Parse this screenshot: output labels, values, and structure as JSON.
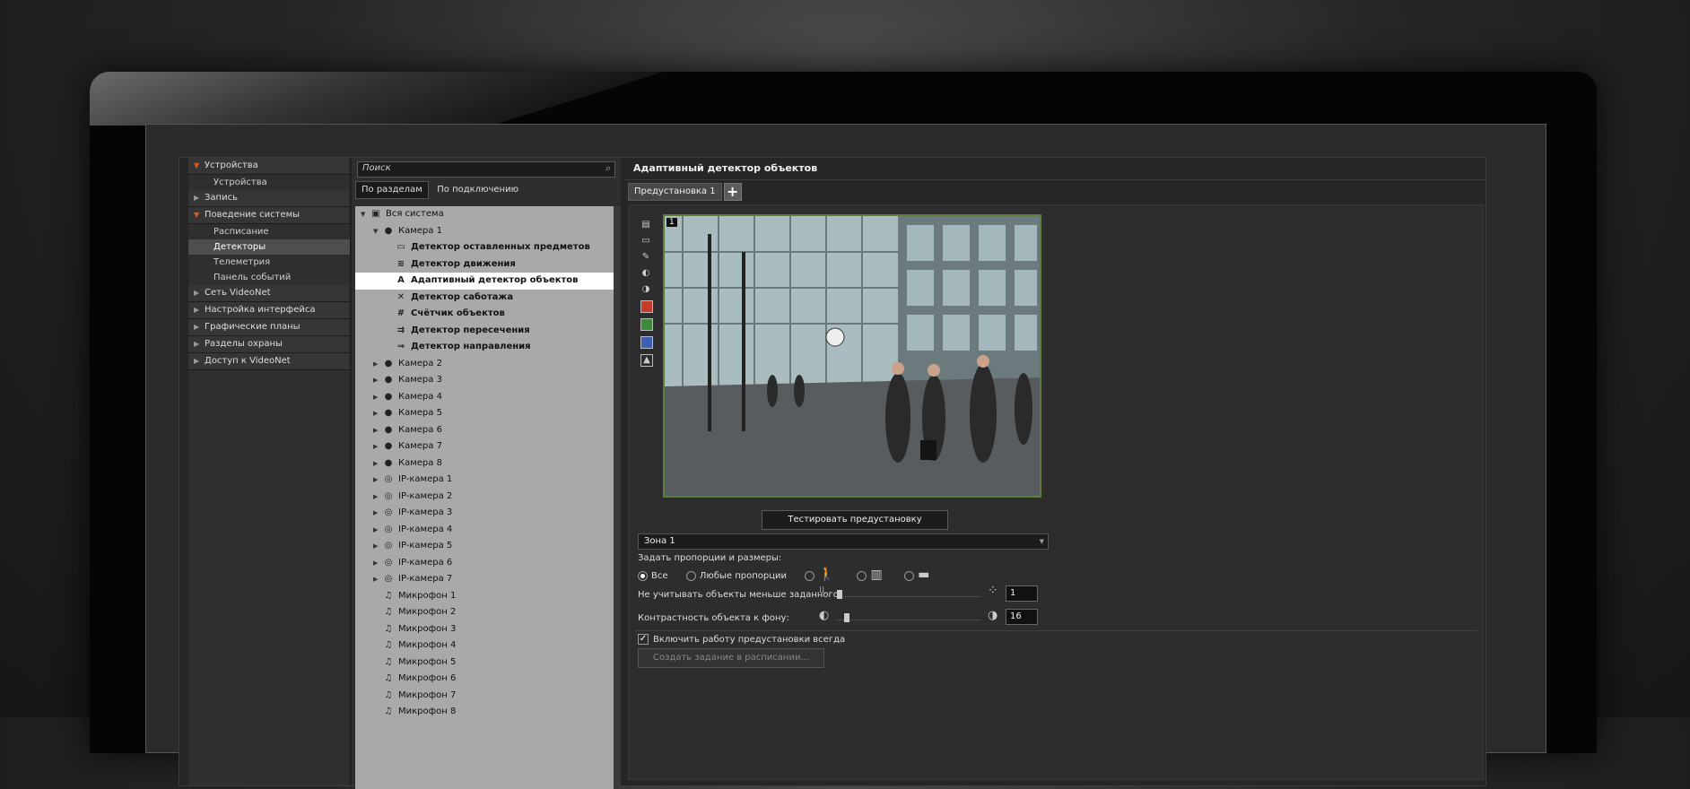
{
  "nav": {
    "sections": [
      {
        "label": "Устройства",
        "open": true,
        "items": [
          {
            "label": "Устройства",
            "selected": false
          }
        ]
      },
      {
        "label": "Запись",
        "open": false,
        "items": []
      },
      {
        "label": "Поведение системы",
        "open": true,
        "items": [
          {
            "label": "Расписание",
            "selected": false
          },
          {
            "label": "Детекторы",
            "selected": true
          },
          {
            "label": "Телеметрия",
            "selected": false
          },
          {
            "label": "Панель событий",
            "selected": false
          }
        ]
      },
      {
        "label": "Сеть VideoNet",
        "open": false,
        "items": []
      },
      {
        "label": "Настройка интерфейса",
        "open": false,
        "items": []
      },
      {
        "label": "Графические планы",
        "open": false,
        "items": []
      },
      {
        "label": "Разделы охраны",
        "open": false,
        "items": []
      },
      {
        "label": "Доступ к VideoNet",
        "open": false,
        "items": []
      }
    ]
  },
  "tree_pane": {
    "search_placeholder": "Поиск",
    "tabs": [
      "По разделам",
      "По подключению"
    ],
    "active_tab": 0,
    "nodes": [
      {
        "label": "Вся система",
        "level": 0,
        "expander": "open",
        "icon": "system-icon"
      },
      {
        "label": "Камера 1",
        "level": 1,
        "expander": "open",
        "icon": "camera-icon"
      },
      {
        "label": "Детектор оставленных предметов",
        "level": 2,
        "bold": true,
        "icon": "abandoned-object-icon"
      },
      {
        "label": "Детектор движения",
        "level": 2,
        "bold": true,
        "icon": "motion-icon"
      },
      {
        "label": "Адаптивный детектор объектов",
        "level": 2,
        "bold": true,
        "selected": true,
        "icon": "adaptive-detector-icon"
      },
      {
        "label": "Детектор саботажа",
        "level": 2,
        "bold": true,
        "icon": "sabotage-icon"
      },
      {
        "label": "Счётчик объектов",
        "level": 2,
        "bold": true,
        "icon": "counter-icon"
      },
      {
        "label": "Детектор пересечения",
        "level": 2,
        "bold": true,
        "icon": "crossing-icon"
      },
      {
        "label": "Детектор направления",
        "level": 2,
        "bold": true,
        "icon": "direction-icon"
      },
      {
        "label": "Камера 2",
        "level": 1,
        "expander": "closed",
        "icon": "camera-icon"
      },
      {
        "label": "Камера 3",
        "level": 1,
        "expander": "closed",
        "icon": "camera-icon"
      },
      {
        "label": "Камера 4",
        "level": 1,
        "expander": "closed",
        "icon": "camera-icon"
      },
      {
        "label": "Камера 5",
        "level": 1,
        "expander": "closed",
        "icon": "camera-icon"
      },
      {
        "label": "Камера 6",
        "level": 1,
        "expander": "closed",
        "icon": "camera-icon"
      },
      {
        "label": "Камера 7",
        "level": 1,
        "expander": "closed",
        "icon": "camera-icon"
      },
      {
        "label": "Камера 8",
        "level": 1,
        "expander": "closed",
        "icon": "camera-icon"
      },
      {
        "label": "IP-камера 1",
        "level": 1,
        "expander": "closed",
        "icon": "ip-camera-icon"
      },
      {
        "label": "IP-камера 2",
        "level": 1,
        "expander": "closed",
        "icon": "ip-camera-icon"
      },
      {
        "label": "IP-камера 3",
        "level": 1,
        "expander": "closed",
        "icon": "ip-camera-icon"
      },
      {
        "label": "IP-камера 4",
        "level": 1,
        "expander": "closed",
        "icon": "ip-camera-icon"
      },
      {
        "label": "IP-камера 5",
        "level": 1,
        "expander": "closed",
        "icon": "ip-camera-icon"
      },
      {
        "label": "IP-камера 6",
        "level": 1,
        "expander": "closed",
        "icon": "ip-camera-icon"
      },
      {
        "label": "IP-камера 7",
        "level": 1,
        "expander": "closed",
        "icon": "ip-camera-icon"
      },
      {
        "label": "Микрофон 1",
        "level": 1,
        "icon": "microphone-icon"
      },
      {
        "label": "Микрофон 2",
        "level": 1,
        "icon": "microphone-icon"
      },
      {
        "label": "Микрофон 3",
        "level": 1,
        "icon": "microphone-icon"
      },
      {
        "label": "Микрофон 4",
        "level": 1,
        "icon": "microphone-icon"
      },
      {
        "label": "Микрофон 5",
        "level": 1,
        "icon": "microphone-icon"
      },
      {
        "label": "Микрофон 6",
        "level": 1,
        "icon": "microphone-icon"
      },
      {
        "label": "Микрофон 7",
        "level": 1,
        "icon": "microphone-icon"
      },
      {
        "label": "Микрофон 8",
        "level": 1,
        "icon": "microphone-icon"
      }
    ]
  },
  "main": {
    "title": "Адаптивный детектор объектов",
    "preset_tab": "Предустановка 1",
    "add_preset_symbol": "+",
    "video_label": "1",
    "test_button": "Тестировать предустановку",
    "zone_value": "Зона 1",
    "proportions_label": "Задать пропорции и размеры:",
    "radio_all": "Все",
    "radio_any": "Любые пропорции",
    "min_size_label": "Не учитывать объекты меньше заданного:",
    "min_size_value": "1",
    "contrast_label": "Контрастность объекта к фону:",
    "contrast_value": "16",
    "always_on_label": "Включить работу предустановки всегда",
    "always_on_checked": true,
    "schedule_button": "Создать задание в расписании..."
  },
  "colors": {
    "accent_arrow": "#e05a1c",
    "video_border": "#5e7d3c",
    "selection": "#ffffff"
  }
}
